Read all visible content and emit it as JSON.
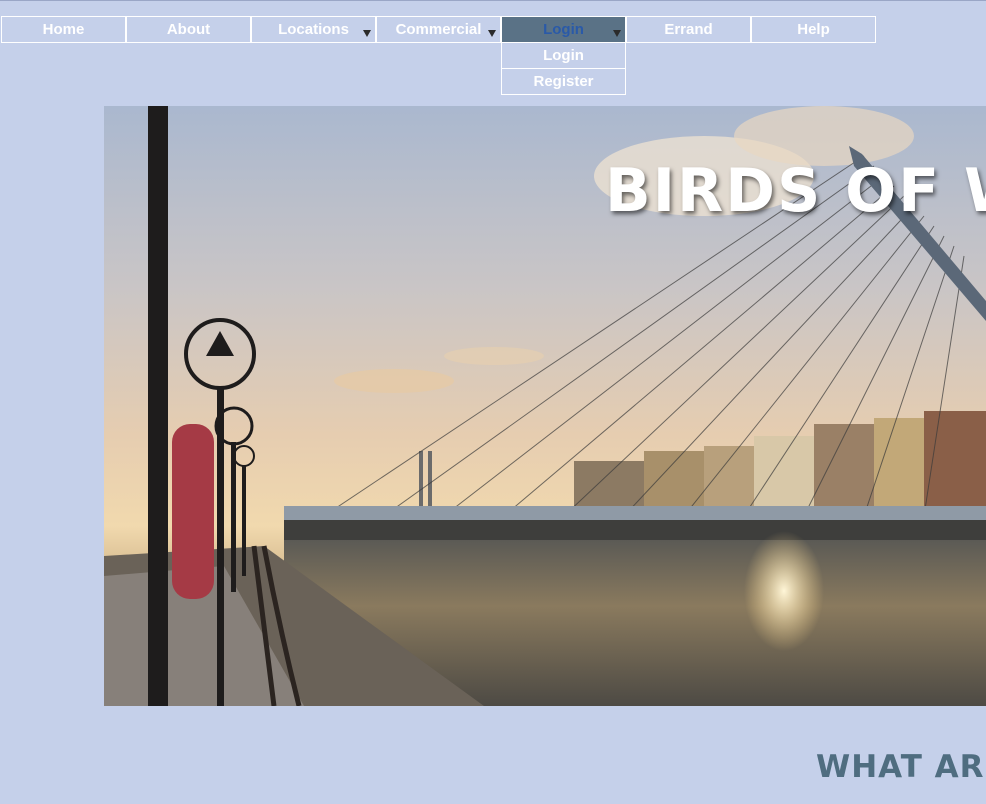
{
  "nav": {
    "items": [
      {
        "label": "Home"
      },
      {
        "label": "About"
      },
      {
        "label": "Locations",
        "has_dropdown": true
      },
      {
        "label": "Commercial",
        "has_dropdown": true
      },
      {
        "label": "Login",
        "has_dropdown": true,
        "active": true
      },
      {
        "label": "Errand"
      },
      {
        "label": "Help"
      }
    ],
    "dropdown": {
      "items": [
        {
          "label": "Login"
        },
        {
          "label": "Register"
        }
      ]
    }
  },
  "hero": {
    "title": "BIRDS OF W",
    "image": "dublin-river-bridge-sunset-photo"
  },
  "section": {
    "heading": "WHAT ARE"
  },
  "colors": {
    "background": "#c5d0ea",
    "nav_active_bg": "#5a7286",
    "nav_active_text": "#2a5aa8",
    "heading": "#4f6d80"
  }
}
